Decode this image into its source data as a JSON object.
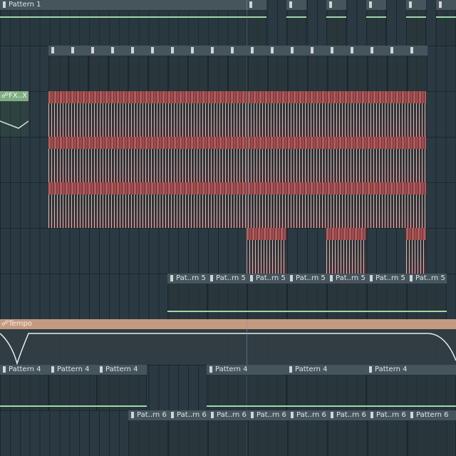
{
  "playlist": {
    "pattern1_label": "Pattern 1",
    "fx_clip_label": "FX..X",
    "tempo_label": "Tempo",
    "pattern5_label": "Pat..rn 5",
    "pattern4_label": "Pattern 4",
    "pattern6_short_label": "Pat..rn 6",
    "pattern6_full_label": "Pattern 6"
  },
  "colors": {
    "background": "#2b3a42",
    "clip_header": "#46545c",
    "note_red": "#b85a5a",
    "green_line": "#9fd8a8",
    "tempo_header": "#c49a83"
  },
  "icons": {
    "pattern_clip": "pattern-clip-icon",
    "automation_clip": "automation-link-icon"
  }
}
